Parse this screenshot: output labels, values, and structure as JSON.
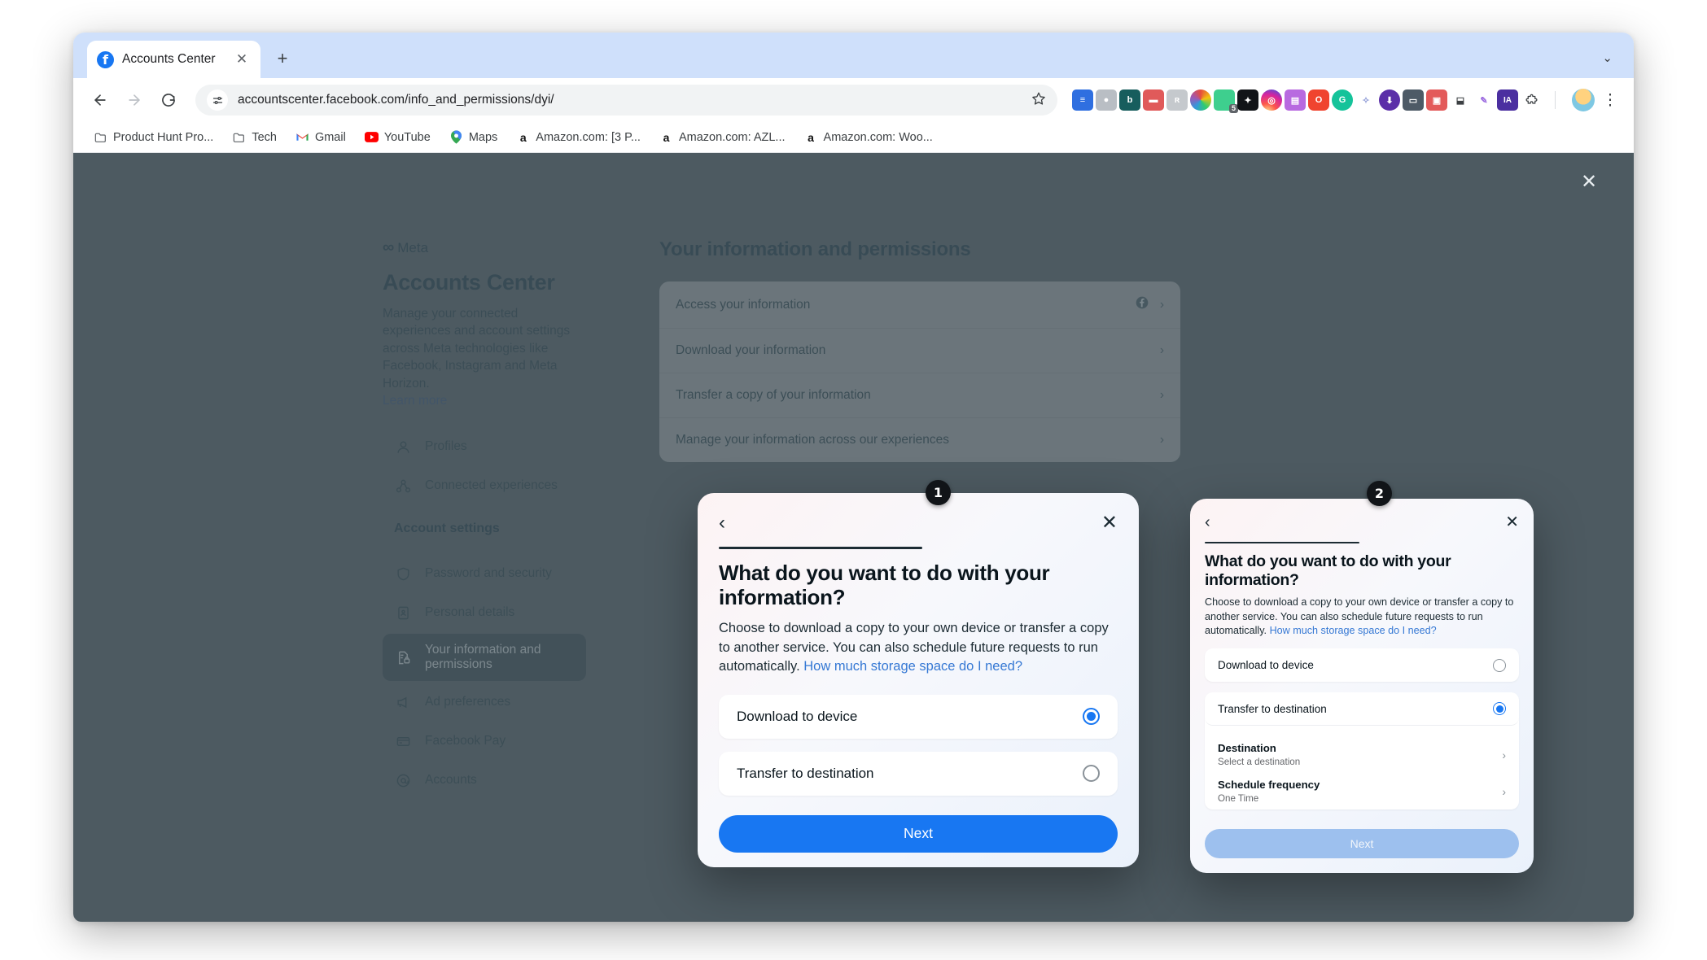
{
  "browser": {
    "tab": {
      "title": "Accounts Center",
      "favicon": "facebook-favicon",
      "close": "✕"
    },
    "new_tab": "+",
    "tab_list_chevron": "⌄",
    "nav": {
      "back": "←",
      "forward": "→",
      "reload": "⟳"
    },
    "omnibox": {
      "site_settings_icon": "tune-icon",
      "url": "accountscenter.facebook.com/info_and_permissions/dyi/",
      "bookmark_star": "☆"
    },
    "extensions_menu_icon": "puzzle-icon",
    "profile_avatar": "user-avatar",
    "more_menu": "⋮",
    "bookmarks": [
      {
        "label": "Product Hunt Pro...",
        "icon": "folder-icon"
      },
      {
        "label": "Tech",
        "icon": "folder-icon"
      },
      {
        "label": "Gmail",
        "icon": "gmail-icon"
      },
      {
        "label": "YouTube",
        "icon": "youtube-icon"
      },
      {
        "label": "Maps",
        "icon": "maps-pin-icon"
      },
      {
        "label": "Amazon.com: [3 P...",
        "icon": "amazon-icon"
      },
      {
        "label": "Amazon.com: AZL...",
        "icon": "amazon-icon"
      },
      {
        "label": "Amazon.com: Woo...",
        "icon": "amazon-icon"
      }
    ],
    "toolbar_extensions": [
      {
        "name": "ext-bars",
        "color": "#2f6fe0",
        "glyph": "≡"
      },
      {
        "name": "ext-avatar",
        "color": "#b9bec4",
        "glyph": "●"
      },
      {
        "name": "ext-bitwarden",
        "color": "#175d5d",
        "glyph": "b"
      },
      {
        "name": "ext-dash",
        "color": "#e05a5a",
        "glyph": "▬"
      },
      {
        "name": "ext-person",
        "color": "#c5c9cd",
        "glyph": "ʀ"
      },
      {
        "name": "ext-color-wheel",
        "color": "#46c28a",
        "glyph": "◍"
      },
      {
        "name": "ext-chat",
        "color": "#3ecf8e",
        "glyph": "◗",
        "badge": "5"
      },
      {
        "name": "ext-dark",
        "color": "#111418",
        "glyph": "✦"
      },
      {
        "name": "ext-instagram",
        "color": "#c13584",
        "glyph": "◎"
      },
      {
        "name": "ext-stack",
        "color": "#b86ae0",
        "glyph": "▤"
      },
      {
        "name": "ext-opera",
        "color": "#f0442f",
        "glyph": "O"
      },
      {
        "name": "ext-grammarly",
        "color": "#15c39a",
        "glyph": "G"
      },
      {
        "name": "ext-sparkle",
        "color": "#8e9bd6",
        "glyph": "✧"
      },
      {
        "name": "ext-download",
        "color": "#5b2fa8",
        "glyph": "⬇"
      },
      {
        "name": "ext-screenshot",
        "color": "#4d5a66",
        "glyph": "▭"
      },
      {
        "name": "ext-image",
        "color": "#e35a5a",
        "glyph": "▣"
      },
      {
        "name": "ext-inbox",
        "color": "#3c4043",
        "glyph": "⬓"
      },
      {
        "name": "ext-feather",
        "color": "#9b6ae0",
        "glyph": "✎"
      },
      {
        "name": "ext-ia",
        "color": "#4b2fa0",
        "glyph": "IA"
      }
    ]
  },
  "page": {
    "brand": "Meta",
    "title": "Accounts Center",
    "description": "Manage your connected experiences and account settings across Meta technologies like Facebook, Instagram and Meta Horizon.",
    "learn_more": "Learn more",
    "nav_primary": [
      {
        "label": "Profiles",
        "icon": "person-icon"
      },
      {
        "label": "Connected experiences",
        "icon": "share-nodes-icon"
      }
    ],
    "nav_section_title": "Account settings",
    "nav_settings": [
      {
        "label": "Password and security",
        "icon": "shield-icon",
        "active": false
      },
      {
        "label": "Personal details",
        "icon": "id-card-icon",
        "active": false
      },
      {
        "label": "Your information and permissions",
        "icon": "file-lock-icon",
        "active": true
      },
      {
        "label": "Ad preferences",
        "icon": "megaphone-icon",
        "active": false
      },
      {
        "label": "Facebook Pay",
        "icon": "credit-card-icon",
        "active": false
      },
      {
        "label": "Accounts",
        "icon": "at-circle-icon",
        "active": false
      }
    ],
    "content_heading": "Your information and permissions",
    "content_rows": [
      {
        "label": "Access your information",
        "badge": "facebook-icon",
        "chevron": "›"
      },
      {
        "label": "Download your information",
        "badge": "",
        "chevron": "›"
      },
      {
        "label": "Transfer a copy of your information",
        "badge": "",
        "chevron": "›"
      },
      {
        "label": "Manage your information across our experiences",
        "badge": "",
        "chevron": "›"
      }
    ],
    "overlay_close": "✕"
  },
  "steps": [
    {
      "number": "1"
    },
    {
      "number": "2"
    }
  ],
  "modal1": {
    "back_icon": "chevron-left-icon",
    "close_icon": "close-icon",
    "title": "What do you want to do with your information?",
    "description_part1": "Choose to download a copy to your own device or transfer a copy to another service. You can also schedule future requests to run automatically. ",
    "description_link": "How much storage space do I need?",
    "options": [
      {
        "label": "Download to device",
        "selected": true
      },
      {
        "label": "Transfer to destination",
        "selected": false
      }
    ],
    "next_label": "Next",
    "next_disabled": false
  },
  "modal2": {
    "back_icon": "chevron-left-icon",
    "close_icon": "close-icon",
    "title": "What do you want to do with your information?",
    "description_part1": "Choose to download a copy to your own device or transfer a copy to another service. You can also schedule future requests to run automatically. ",
    "description_link": "How much storage space do I need?",
    "option_download": {
      "label": "Download to device",
      "selected": false
    },
    "option_transfer": {
      "label": "Transfer to destination",
      "selected": true
    },
    "sub_rows": [
      {
        "title": "Destination",
        "value": "Select a destination",
        "chevron": "›"
      },
      {
        "title": "Schedule frequency",
        "value": "One Time",
        "chevron": "›"
      }
    ],
    "next_label": "Next",
    "next_disabled": true
  },
  "colors": {
    "accent_blue": "#1877f2",
    "link_blue": "#3578d4",
    "disabled_blue": "#9dc0ee",
    "badge_black": "#111418",
    "overlay": "#4d5a61"
  }
}
